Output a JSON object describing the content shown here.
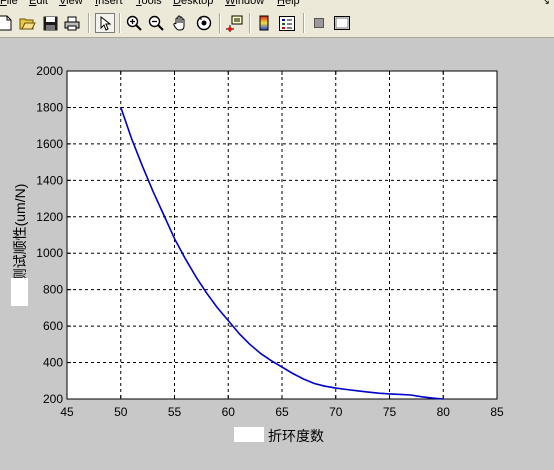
{
  "menubar": {
    "items": [
      {
        "label": "File",
        "key": "F"
      },
      {
        "label": "Edit",
        "key": "E"
      },
      {
        "label": "View",
        "key": "V"
      },
      {
        "label": "Insert",
        "key": "I"
      },
      {
        "label": "Tools",
        "key": "T"
      },
      {
        "label": "Desktop",
        "key": "D"
      },
      {
        "label": "Window",
        "key": "W"
      },
      {
        "label": "Help",
        "key": "H"
      }
    ]
  },
  "toolbar": {
    "buttons": [
      "new-file-icon",
      "open-folder-icon",
      "save-icon",
      "print-icon",
      "edit-plot-arrow-icon",
      "zoom-in-icon",
      "zoom-out-icon",
      "pan-hand-icon",
      "rotate-3d-icon",
      "data-cursor-icon",
      "colorbar-icon",
      "legend-icon",
      "hide-plot-tools-icon",
      "show-plot-tools-icon"
    ]
  },
  "colors": {
    "line": "#0000cc",
    "figure_bg": "#c8c8c8",
    "axes_bg": "#ffffff"
  },
  "chart_data": {
    "type": "line",
    "title": "",
    "xlabel": "折环度数",
    "ylabel": "测试顺性(um/N)",
    "xlim": [
      45,
      85
    ],
    "ylim": [
      200,
      2000
    ],
    "xticks": [
      45,
      50,
      55,
      60,
      65,
      70,
      75,
      80,
      85
    ],
    "yticks": [
      200,
      400,
      600,
      800,
      1000,
      1200,
      1400,
      1600,
      1800,
      2000
    ],
    "grid": true,
    "series": [
      {
        "x": [
          50,
          51,
          52,
          53,
          54,
          55,
          56,
          57,
          58,
          59,
          60,
          61,
          62,
          63,
          64,
          65,
          66,
          67,
          68,
          69,
          70,
          71,
          72,
          73,
          74,
          75,
          76,
          77,
          78,
          79,
          80
        ],
        "y": [
          1800,
          1630,
          1480,
          1340,
          1210,
          1080,
          970,
          870,
          780,
          700,
          630,
          560,
          500,
          450,
          410,
          375,
          340,
          310,
          285,
          270,
          260,
          252,
          245,
          238,
          232,
          228,
          225,
          222,
          212,
          205,
          200
        ]
      }
    ]
  }
}
